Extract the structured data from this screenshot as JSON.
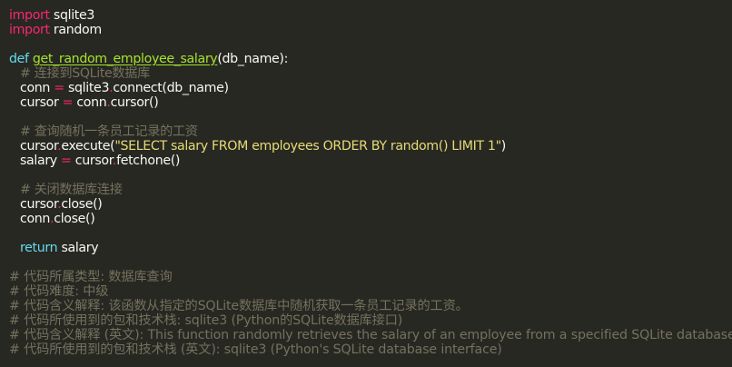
{
  "code": {
    "line1": {
      "keyword": "import",
      "module": "sqlite3"
    },
    "line2": {
      "keyword": "import",
      "module": "random"
    },
    "line4": {
      "keyword": "def",
      "name": "get_random_employee_salary",
      "params": "(db_name):"
    },
    "line5": {
      "comment": "# 连接到SQLite数据库"
    },
    "line6": {
      "lhs": "conn",
      "op": "=",
      "obj": "sqlite3",
      "call": "connect(db_name)"
    },
    "line7": {
      "lhs": "cursor",
      "op": "=",
      "obj": "conn",
      "call": "cursor()"
    },
    "line9": {
      "comment": "# 查询随机一条员工记录的工资"
    },
    "line10": {
      "obj": "cursor",
      "call_open": "execute(",
      "string": "\"SELECT salary FROM employees ORDER BY random() LIMIT 1\"",
      "call_close": ")"
    },
    "line11": {
      "lhs": "salary",
      "op": "=",
      "obj": "cursor",
      "call": "fetchone()"
    },
    "line13": {
      "comment": "# 关闭数据库连接"
    },
    "line14": {
      "obj": "cursor",
      "call": "close()"
    },
    "line15": {
      "obj": "conn",
      "call": "close()"
    },
    "line17": {
      "keyword": "return",
      "value": "salary"
    }
  },
  "notes": [
    "# 代码所属类型: 数据库查询",
    "# 代码难度: 中级",
    "# 代码含义解释: 该函数从指定的SQLite数据库中随机获取一条员工记录的工资。",
    "# 代码所使用到的包和技术栈: sqlite3 (Python的SQLite数据库接口)",
    "# 代码含义解释 (英文): This function randomly retrieves the salary of an employee from a specified SQLite database.",
    "# 代码所使用到的包和技术栈 (英文): sqlite3 (Python's SQLite database interface)"
  ],
  "colors": {
    "background": "#272822",
    "keyword": "#f92672",
    "def": "#66d9ef",
    "function": "#a6e22e",
    "comment": "#75715e",
    "string": "#e6db74",
    "text": "#f8f8f2"
  }
}
